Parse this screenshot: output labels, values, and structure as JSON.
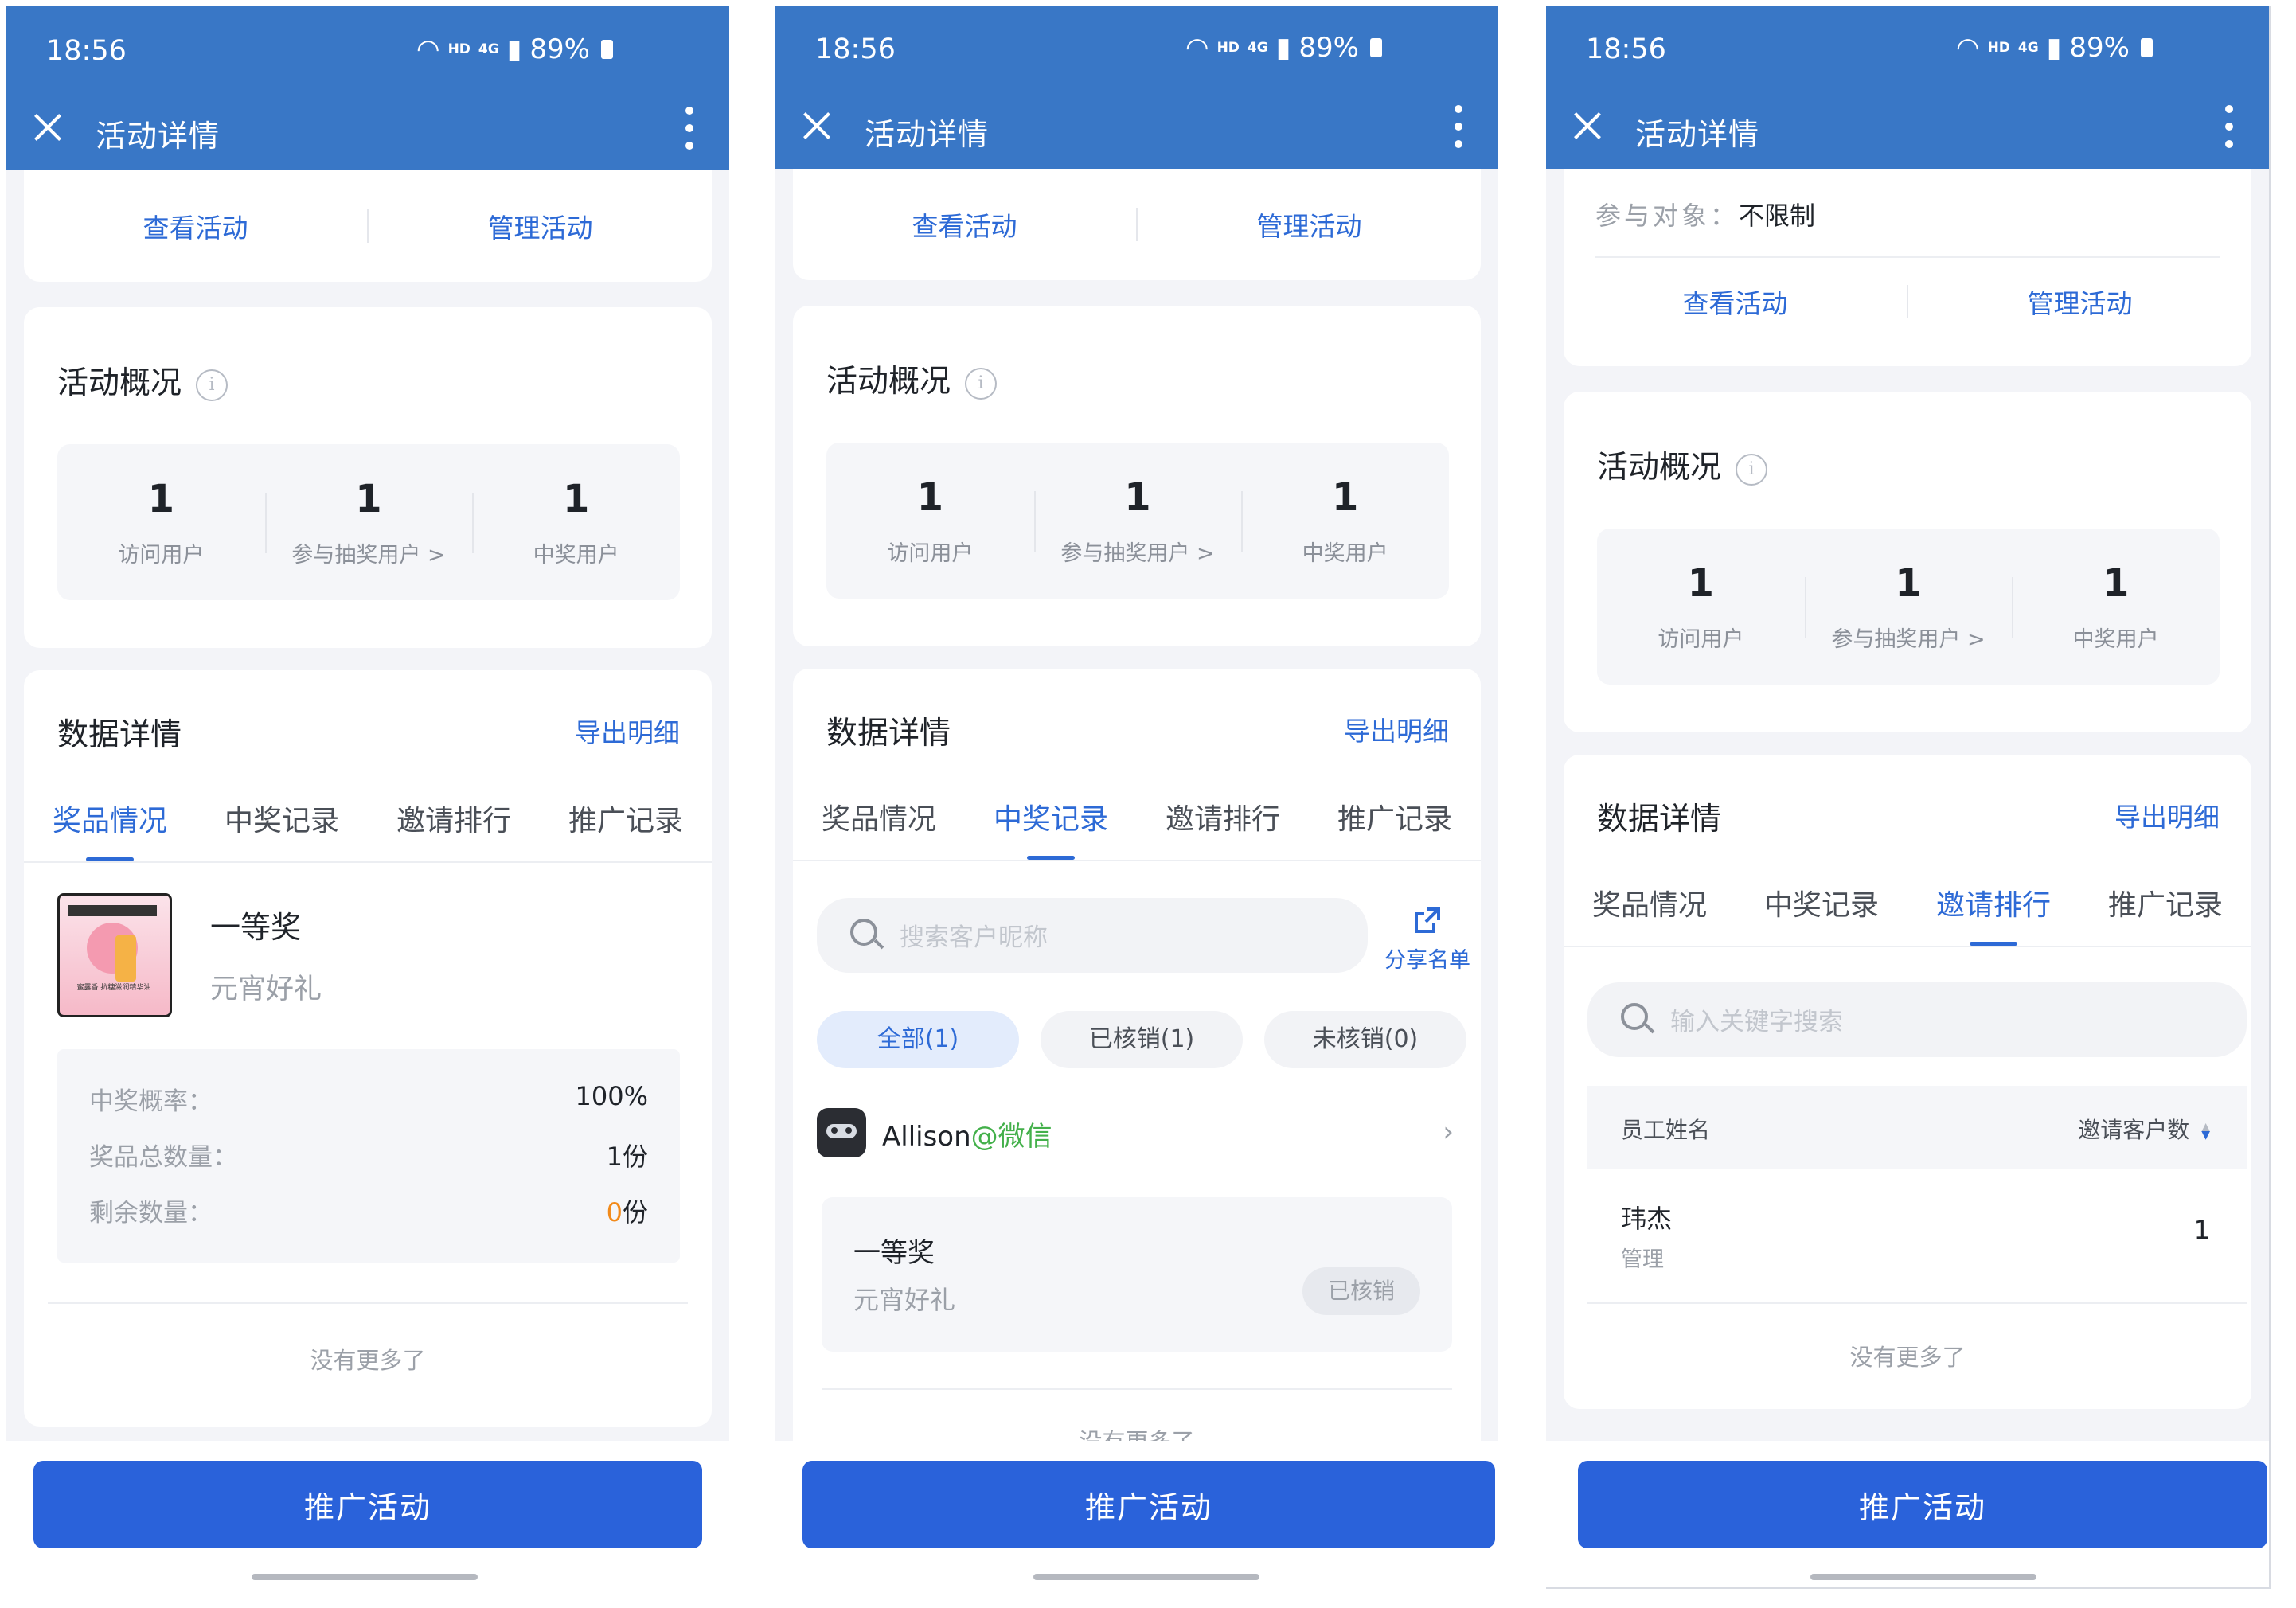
{
  "colors": {
    "appbar": "#3977c6",
    "primary": "#2a62da",
    "link": "#2d6ad6",
    "accent_orange": "#f28a1a",
    "wechat_green": "#43b04a"
  },
  "status": {
    "time": "18:56",
    "hd": "HD",
    "net": "4G",
    "battery": "89%"
  },
  "appbar": {
    "title": "活动详情"
  },
  "activity_links": {
    "view": "查看活动",
    "manage": "管理活动"
  },
  "participation": {
    "label": "参与对象：",
    "value": "不限制"
  },
  "overview": {
    "title": "活动概况",
    "info_icon": "i",
    "stats": [
      {
        "value": "1",
        "label": "访问用户"
      },
      {
        "value": "1",
        "label": "参与抽奖用户 >"
      },
      {
        "value": "1",
        "label": "中奖用户"
      }
    ]
  },
  "details": {
    "title": "数据详情",
    "export": "导出明细",
    "tabs": [
      "奖品情况",
      "中奖记录",
      "邀请排行",
      "推广记录"
    ]
  },
  "prize": {
    "name": "一等奖",
    "desc": "元宵好礼",
    "thumb_caption": "蜜露香 抗糖滋润精华油",
    "rows": [
      {
        "label": "中奖概率：",
        "value": "100%",
        "unit": ""
      },
      {
        "label": "奖品总数量：",
        "value": "1",
        "unit": "份"
      },
      {
        "label": "剩余数量：",
        "value": "0",
        "unit": "份"
      }
    ]
  },
  "no_more": "没有更多了",
  "winners": {
    "search_placeholder": "搜索客户昵称",
    "share": "分享名单",
    "filters": [
      "全部(1)",
      "已核销(1)",
      "未核销(0)"
    ],
    "user": {
      "name": "Allison",
      "source": "@微信"
    },
    "record": {
      "title": "一等奖",
      "desc": "元宵好礼",
      "status": "已核销"
    }
  },
  "ranking": {
    "search_placeholder": "输入关键字搜索",
    "col_name": "员工姓名",
    "col_count": "邀请客户数",
    "rows": [
      {
        "name": "玮杰",
        "dept": "管理",
        "count": "1"
      }
    ]
  },
  "cta": "推广活动"
}
